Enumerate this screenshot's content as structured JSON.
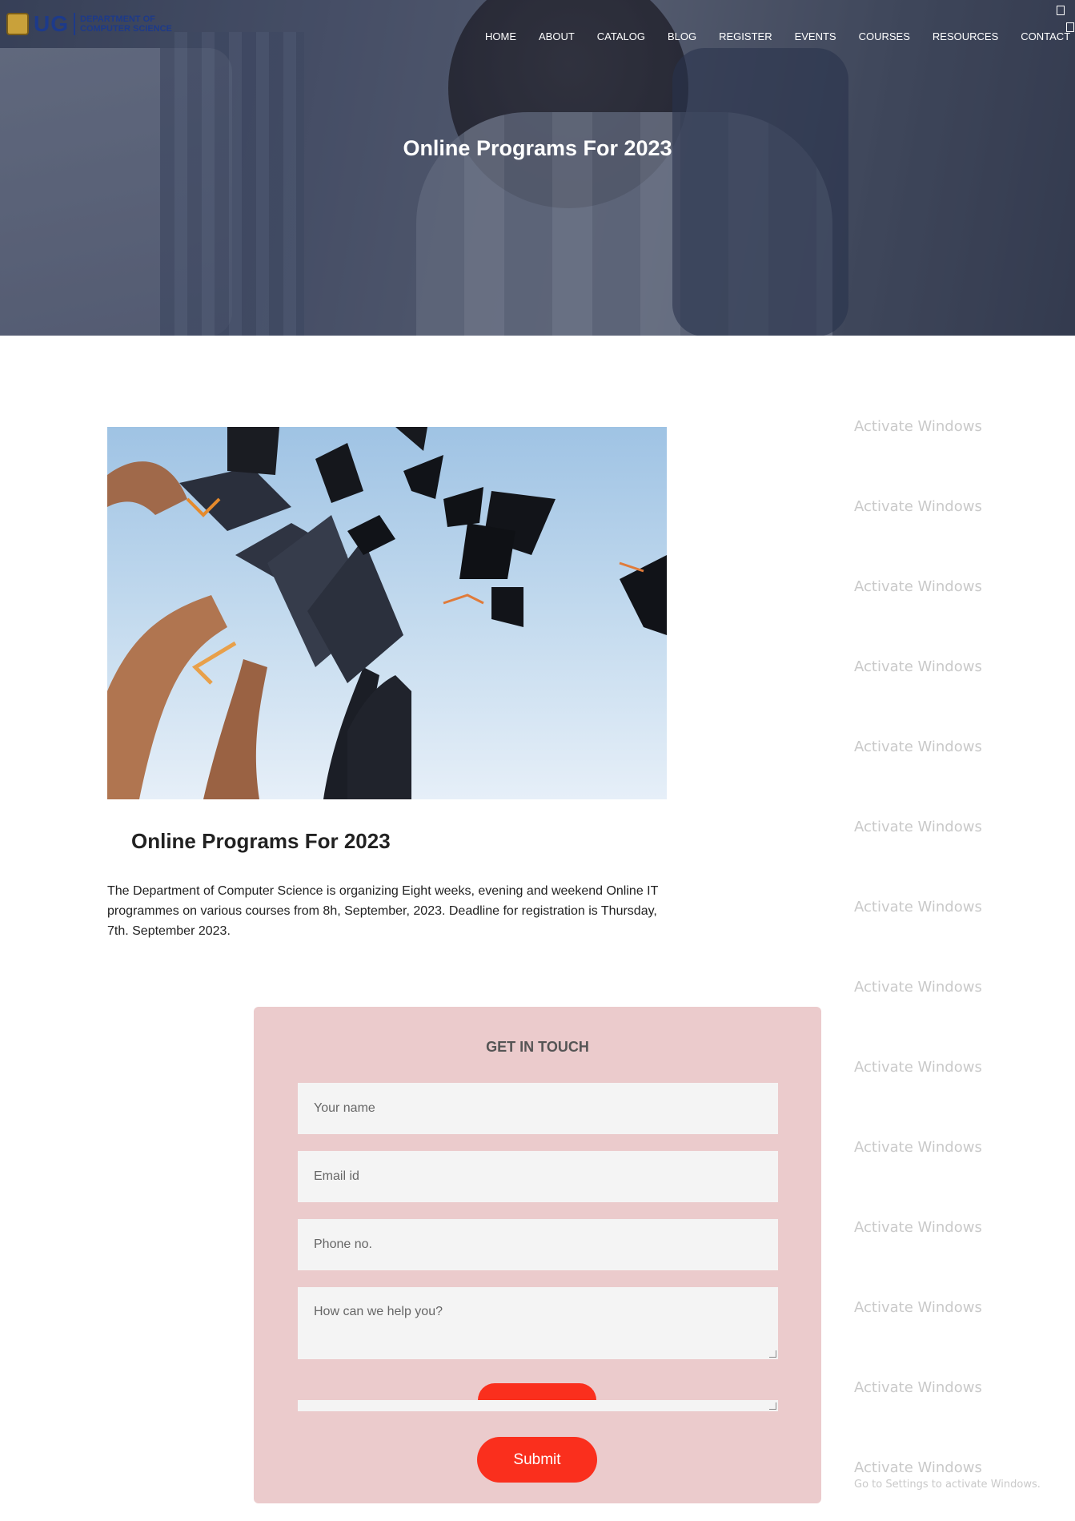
{
  "header": {
    "logo_ug": "UG",
    "logo_dept_line1": "DEPARTMENT OF",
    "logo_dept_line2": "COMPUTER SCIENCE",
    "nav": [
      "HOME",
      "ABOUT",
      "CATALOG",
      "BLOG",
      "REGISTER",
      "EVENTS",
      "COURSES",
      "RESOURCES",
      "CONTACT"
    ]
  },
  "hero": {
    "title": "Online Programs For 2023"
  },
  "post": {
    "title": "Online Programs For 2023",
    "body": "The Department of Computer Science is organizing Eight weeks, evening and weekend Online IT programmes on various courses from 8h, September, 2023. Deadline for registration is Thursday, 7th. September 2023."
  },
  "form": {
    "title": "GET IN TOUCH",
    "name_placeholder": "Your name",
    "email_placeholder": "Email id",
    "phone_placeholder": "Phone no.",
    "message_placeholder": "How can we help you?",
    "submit_label": "Submit"
  },
  "watermark": {
    "text": "Activate Windows",
    "subtext": "Go to Settings to activate Windows."
  },
  "colors": {
    "accent": "#fa2f1d",
    "form_bg": "#ebcbcc",
    "field_bg": "#f4f4f4"
  }
}
